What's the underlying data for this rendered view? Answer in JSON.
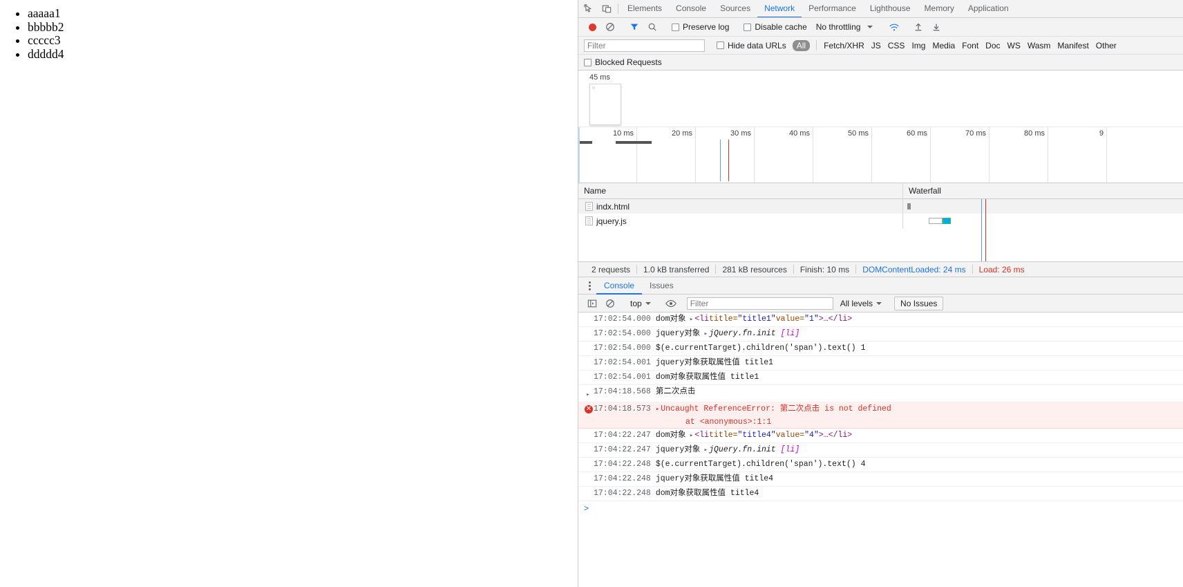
{
  "page": {
    "list_items": [
      "aaaaa1",
      "bbbbb2",
      "ccccc3",
      "ddddd4"
    ]
  },
  "devtools": {
    "main_tabs": [
      {
        "label": "Elements",
        "active": false
      },
      {
        "label": "Console",
        "active": false
      },
      {
        "label": "Sources",
        "active": false
      },
      {
        "label": "Network",
        "active": true
      },
      {
        "label": "Performance",
        "active": false
      },
      {
        "label": "Lighthouse",
        "active": false
      },
      {
        "label": "Memory",
        "active": false
      },
      {
        "label": "Application",
        "active": false
      }
    ],
    "icons": {
      "inspect": "inspect-element-icon",
      "device": "device-toolbar-icon",
      "record": "record-button-icon",
      "clear": "clear-icon",
      "filter": "filter-icon",
      "search": "search-icon",
      "import": "import-har-icon",
      "export": "export-har-icon",
      "online": "network-conditions-icon"
    },
    "network_toolbar": {
      "preserve_log": "Preserve log",
      "disable_cache": "Disable cache",
      "throttling": "No throttling"
    },
    "filter_bar": {
      "filter_placeholder": "Filter",
      "filter_value": "",
      "hide_data_urls": "Hide data URLs",
      "all_pill": "All",
      "types": [
        "Fetch/XHR",
        "JS",
        "CSS",
        "Img",
        "Media",
        "Font",
        "Doc",
        "WS",
        "Wasm",
        "Manifest",
        "Other"
      ],
      "blocked_requests": "Blocked Requests"
    },
    "overview": {
      "filmstrip_time": "45 ms",
      "ruler_ticks": [
        "10 ms",
        "20 ms",
        "30 ms",
        "40 ms",
        "50 ms",
        "60 ms",
        "70 ms",
        "80 ms",
        "9"
      ]
    },
    "table": {
      "columns": [
        "Name",
        "Waterfall"
      ],
      "rows": [
        {
          "name": "indx.html"
        },
        {
          "name": "jquery.js"
        }
      ]
    },
    "summary": {
      "requests": "2 requests",
      "transferred": "1.0 kB transferred",
      "resources": "281 kB resources",
      "finish": "Finish: 10 ms",
      "dom_content_loaded": "DOMContentLoaded: 24 ms",
      "load": "Load: 26 ms"
    },
    "drawer": {
      "tabs": [
        {
          "label": "Console",
          "active": true
        },
        {
          "label": "Issues",
          "active": false
        }
      ],
      "console_toolbar": {
        "context": "top",
        "filter_placeholder": "Filter",
        "filter_value": "",
        "levels": "All levels",
        "issues": "No Issues"
      },
      "log_rows": [
        {
          "ts": "17:02:54.000",
          "kind": "object",
          "label": "dom对象",
          "expand": true,
          "tag_open": "<li ",
          "attr1": "title=",
          "val1": "\"title1\"",
          "attr2": " value=",
          "val2": "\"1\"",
          "tag_close": ">…</li>"
        },
        {
          "ts": "17:02:54.000",
          "kind": "jquery",
          "label": "jquery对象",
          "expand": true,
          "text": "jQuery.fn.init ",
          "cls": "[li]"
        },
        {
          "ts": "17:02:54.000",
          "kind": "plain",
          "text": "$(e.currentTarget).children('span').text() 1"
        },
        {
          "ts": "17:02:54.001",
          "kind": "plain",
          "text": "jquery对象获取属性值 title1"
        },
        {
          "ts": "17:02:54.001",
          "kind": "plain",
          "text": "dom对象获取属性值 title1"
        },
        {
          "ts": "17:04:18.568",
          "kind": "input",
          "text": "第二次点击"
        },
        {
          "ts": "17:04:18.573",
          "kind": "error",
          "text": "Uncaught ReferenceError: 第二次点击 is not defined",
          "sub": "at <anonymous>:1:1"
        },
        {
          "ts": "17:04:22.247",
          "kind": "object",
          "label": "dom对象",
          "expand": true,
          "tag_open": "<li ",
          "attr1": "title=",
          "val1": "\"title4\"",
          "attr2": " value=",
          "val2": "\"4\"",
          "tag_close": ">…</li>"
        },
        {
          "ts": "17:04:22.247",
          "kind": "jquery",
          "label": "jquery对象",
          "expand": true,
          "text": "jQuery.fn.init ",
          "cls": "[li]"
        },
        {
          "ts": "17:04:22.248",
          "kind": "plain",
          "text": "$(e.currentTarget).children('span').text() 4"
        },
        {
          "ts": "17:04:22.248",
          "kind": "plain",
          "text": "jquery对象获取属性值 title4"
        },
        {
          "ts": "17:04:22.248",
          "kind": "plain",
          "text": "dom对象获取属性值 title4"
        }
      ],
      "prompt": ">"
    },
    "colors": {
      "accent": "#1a73e8",
      "error": "#d93025",
      "record": "#e1382d",
      "dcl_marker": "#5c9ce6",
      "load_marker": "#d93025",
      "download_bar": "#00a8ff"
    }
  }
}
